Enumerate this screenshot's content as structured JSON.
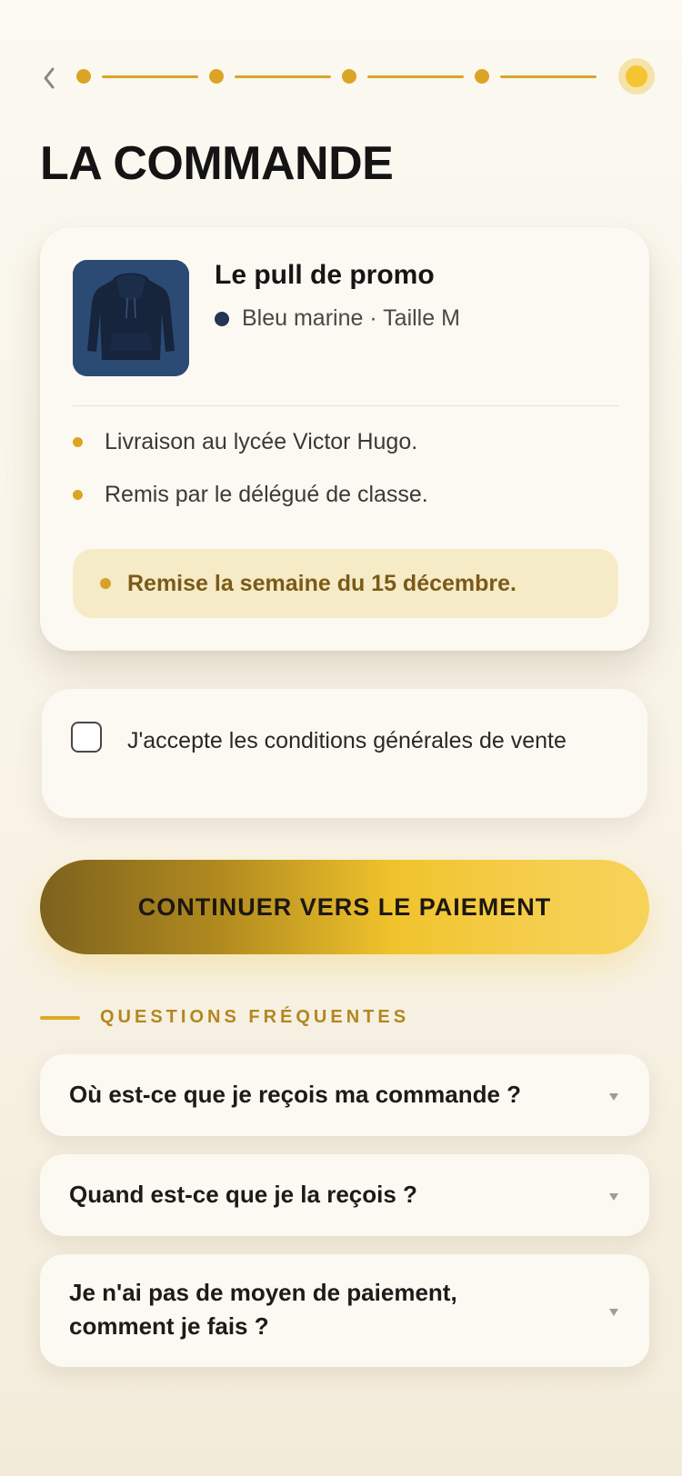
{
  "header": {
    "title": "LA COMMANDE",
    "back_icon": "chevron-left-icon",
    "progress": {
      "total_steps": 5,
      "current_step": 5
    }
  },
  "order": {
    "product_name": "Le pull de promo",
    "variant": "Bleu marine · Taille M",
    "variant_color": "#233656",
    "thumbnail_icon": "hoodie-image",
    "details": [
      "Livraison au lycée Victor Hugo.",
      "Remis par le délégué de classe."
    ],
    "note": "Remise la semaine du 15 décembre."
  },
  "terms": {
    "label": "J'accepte les conditions générales de vente",
    "checked": false
  },
  "cta": {
    "label": "CONTINUER VERS LE PAIEMENT"
  },
  "faq": {
    "heading": "QUESTIONS FRÉQUENTES",
    "items": [
      {
        "question": "Où est-ce que je reçois ma commande ?"
      },
      {
        "question": "Quand est-ce que je la reçois ?"
      },
      {
        "question": "Je n'ai pas de moyen de paiement, comment je fais ?"
      }
    ]
  },
  "colors": {
    "accent": "#dca425",
    "accent_bright": "#f4c530",
    "note_bg": "#f6ebc7",
    "note_text": "#7a5a17",
    "card_bg": "#fcf9f2"
  }
}
